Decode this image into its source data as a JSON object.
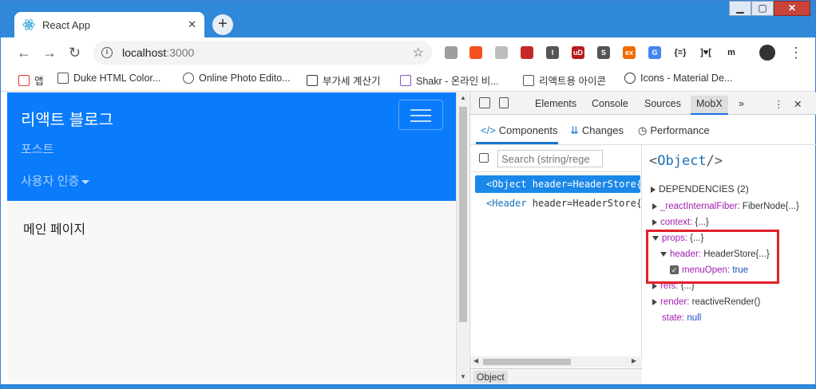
{
  "browser": {
    "tab_title": "React App",
    "tab_close": "✕",
    "new_tab": "+",
    "url_host": "localhost",
    "url_port": ":3000",
    "window_controls": {
      "minimize": "▁",
      "maximize": "▢",
      "close": "✕"
    }
  },
  "extensions": [
    {
      "name": "ext-1",
      "label": "",
      "color": "#9e9e9e"
    },
    {
      "name": "ext-2",
      "label": "",
      "color": "#f4511e"
    },
    {
      "name": "ext-3",
      "label": "",
      "color": "#bdbdbd"
    },
    {
      "name": "ext-4",
      "label": "",
      "color": "#c62828"
    },
    {
      "name": "ext-5",
      "label": "I",
      "color": "#555555"
    },
    {
      "name": "ext-6",
      "label": "uD",
      "color": "#b71c1c"
    },
    {
      "name": "ext-7",
      "label": "S",
      "color": "#555555"
    },
    {
      "name": "ext-8",
      "label": "ex",
      "color": "#ef6c00"
    },
    {
      "name": "ext-9",
      "label": "G",
      "color": "#4285f4"
    },
    {
      "name": "ext-10",
      "label": "{≡}",
      "color": "#ffffff"
    },
    {
      "name": "ext-11",
      "label": "]♥[",
      "color": "#ffffff"
    },
    {
      "name": "ext-12",
      "label": "m",
      "color": "#ffffff"
    }
  ],
  "bookmarks": [
    {
      "label": "앱",
      "icon": "apps-grid-icon"
    },
    {
      "label": "Duke HTML Color...",
      "icon": "page-icon"
    },
    {
      "label": "Online Photo Edito...",
      "icon": "aperture-icon"
    },
    {
      "label": "부가세 계산기",
      "icon": "calculator-icon"
    },
    {
      "label": "Shakr - 온라인 비...",
      "icon": "shakr-icon"
    },
    {
      "label": "리액트용 아이콘",
      "icon": "page-icon"
    },
    {
      "label": "Icons - Material De...",
      "icon": "material-icon"
    }
  ],
  "page": {
    "brand": "리액트 블로그",
    "nav_posts": "포스트",
    "nav_auth": "사용자 인증",
    "main_text": "메인 페이지"
  },
  "devtools": {
    "tabs": [
      "Elements",
      "Console",
      "Sources",
      "MobX"
    ],
    "active_tab": "MobX",
    "more": "»",
    "mobx_tabs": [
      {
        "icon": "</>",
        "label": "Components"
      },
      {
        "icon": "⇊",
        "label": "Changes"
      },
      {
        "icon": "◷",
        "label": "Performance"
      }
    ],
    "search_placeholder": "Search (string/rege",
    "tree_nodes": [
      {
        "tag": "<Object",
        "attrs": " header=HeaderStore{",
        "selected": true
      },
      {
        "tag": "<Header",
        "attrs": " header=HeaderStore{",
        "selected": false
      }
    ],
    "breadcrumb": "Object",
    "inspector": {
      "title_open": "<",
      "title_name": "Object",
      "title_close": "/>",
      "dependencies": "DEPENDENCIES (2)",
      "props": [
        {
          "key": "_reactInternalFiber:",
          "value": "FiberNode{...}"
        },
        {
          "key": "context:",
          "value": "{...}"
        },
        {
          "key": "props:",
          "value": "{...}"
        },
        {
          "key": "header:",
          "value": "HeaderStore{...}"
        },
        {
          "key": "menuOpen:",
          "value": "true"
        },
        {
          "key": "refs:",
          "value": "{...}"
        },
        {
          "key": "render:",
          "value": "reactiveRender()"
        },
        {
          "key": "state:",
          "value": "null"
        }
      ]
    }
  }
}
